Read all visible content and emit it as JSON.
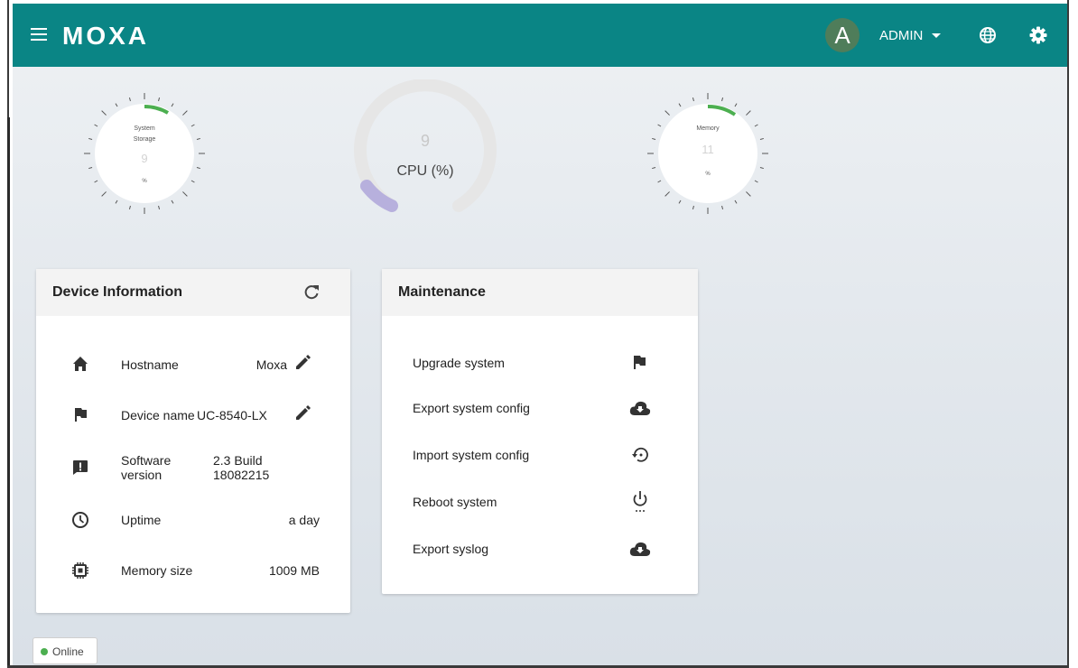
{
  "topbar": {
    "logo_text": "MOXA",
    "avatar_letter": "A",
    "user_name": "ADMIN"
  },
  "gauges": {
    "storage": {
      "line1": "System",
      "line2": "Storage",
      "value": "9",
      "unit": "%"
    },
    "cpu": {
      "value": "9",
      "label": "CPU (%)"
    },
    "memory": {
      "line1": "Memory",
      "value": "11",
      "unit": "%"
    }
  },
  "device_info": {
    "title": "Device Information",
    "rows": [
      {
        "label": "Hostname",
        "value": "Moxa"
      },
      {
        "label": "Device name",
        "value": "UC-8540-LX"
      },
      {
        "label_line1": "Software",
        "label_line2": "version",
        "value_line1": "2.3 Build",
        "value_line2": "18082215"
      },
      {
        "label": "Uptime",
        "value": "a day"
      },
      {
        "label": "Memory size",
        "value": "1009 MB"
      }
    ]
  },
  "maintenance": {
    "title": "Maintenance",
    "items": [
      {
        "label": "Upgrade system"
      },
      {
        "label": "Export system config"
      },
      {
        "label": "Import system config"
      },
      {
        "label": "Reboot system"
      },
      {
        "label": "Export syslog"
      }
    ]
  },
  "status": {
    "label": "Online"
  },
  "colors": {
    "topbar": "#0a8585",
    "accent_green": "#4caf50",
    "cpu_arc": "#b7b0dd"
  }
}
